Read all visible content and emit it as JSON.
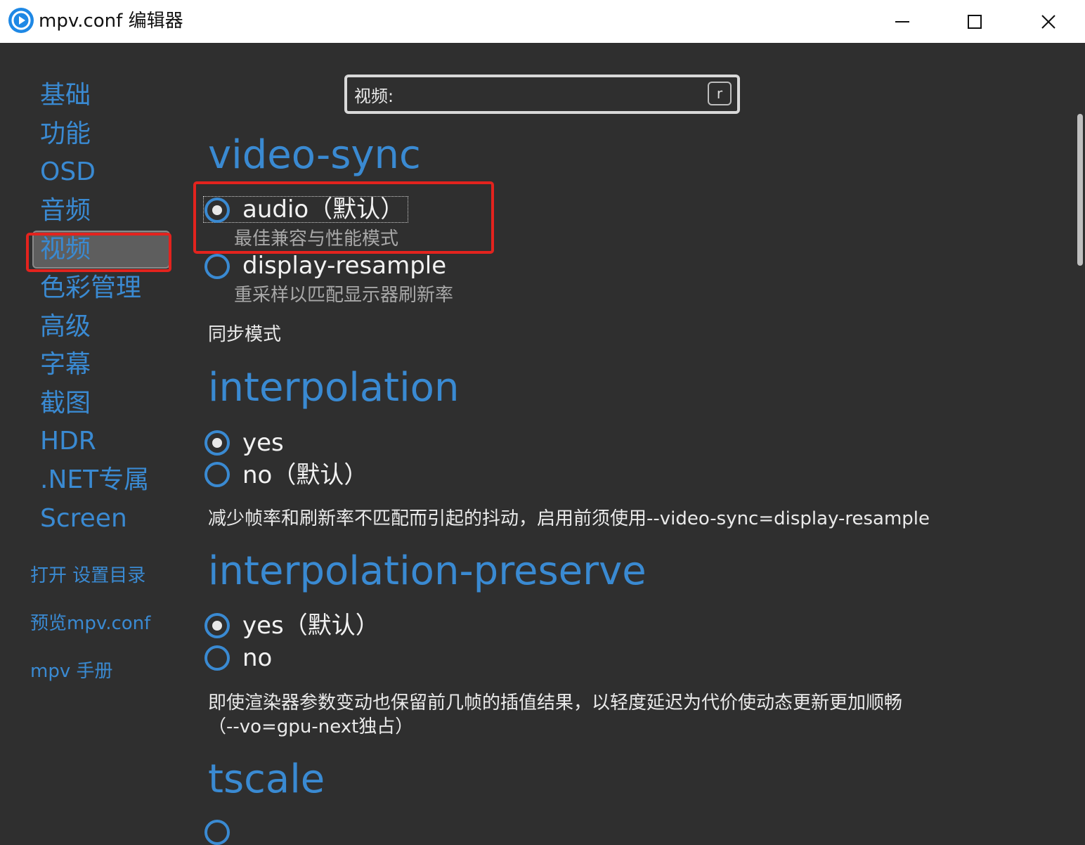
{
  "window": {
    "title": "mpv.conf 编辑器"
  },
  "sidebar": {
    "items": [
      {
        "label": "基础"
      },
      {
        "label": "功能"
      },
      {
        "label": "OSD"
      },
      {
        "label": "音频"
      },
      {
        "label": "视频"
      },
      {
        "label": "色彩管理"
      },
      {
        "label": "高级"
      },
      {
        "label": "字幕"
      },
      {
        "label": "截图"
      },
      {
        "label": "HDR"
      },
      {
        "label": ".NET专属"
      },
      {
        "label": "Screen"
      }
    ],
    "selected": "视频",
    "links": [
      {
        "label": "打开 设置目录"
      },
      {
        "label": "预览mpv.conf"
      },
      {
        "label": "mpv 手册"
      }
    ]
  },
  "search": {
    "value": "视频:",
    "shortcut_key": "r"
  },
  "sections": [
    {
      "title": "video-sync",
      "options": [
        {
          "label": "audio（默认）",
          "description": "最佳兼容与性能模式",
          "checked": true
        },
        {
          "label": "display-resample",
          "description": "重采样以匹配显示器刷新率",
          "checked": false
        }
      ],
      "help": "同步模式"
    },
    {
      "title": "interpolation",
      "options": [
        {
          "label": "yes",
          "checked": true
        },
        {
          "label": "no（默认）",
          "checked": false
        }
      ],
      "help": "减少帧率和刷新率不匹配而引起的抖动，启用前须使用--video-sync=display-resample"
    },
    {
      "title": "interpolation-preserve",
      "options": [
        {
          "label": "yes（默认）",
          "checked": true
        },
        {
          "label": "no",
          "checked": false
        }
      ],
      "help": "即使渲染器参数变动也保留前几帧的插值结果，以轻度延迟为代价使动态更新更加顺畅",
      "help_line2": "（--vo=gpu-next独占）"
    },
    {
      "title": "tscale"
    }
  ],
  "colors": {
    "accent": "#3a8ad2",
    "background": "#2f2f2f",
    "highlight_box": "#e3231e"
  }
}
